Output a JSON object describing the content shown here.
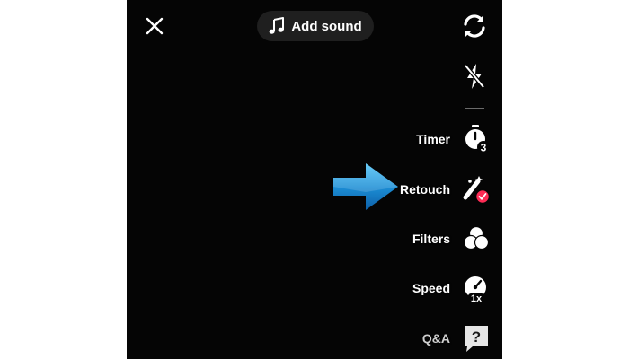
{
  "top_bar": {
    "add_sound_label": "Add sound"
  },
  "tools": {
    "timer": {
      "label": "Timer",
      "badge": "3"
    },
    "retouch": {
      "label": "Retouch",
      "active": true
    },
    "filters": {
      "label": "Filters"
    },
    "speed": {
      "label": "Speed",
      "badge": "1x"
    },
    "qa": {
      "label": "Q&A",
      "icon_text": "?"
    }
  },
  "icons": {
    "close": "close-icon",
    "sound": "music-note-icon",
    "flip": "flip-camera-icon",
    "flash": "flash-off-icon",
    "timer": "timer-icon",
    "retouch": "retouch-wand-icon",
    "filters": "filters-icon",
    "speed": "speed-gauge-icon",
    "qa": "qa-bubble-icon",
    "pointer": "blue-arrow-icon"
  },
  "colors": {
    "screen_background": "#050505",
    "text": "#ffffff",
    "active_badge": "#fe2c55",
    "arrow": "#1c8fd6"
  }
}
